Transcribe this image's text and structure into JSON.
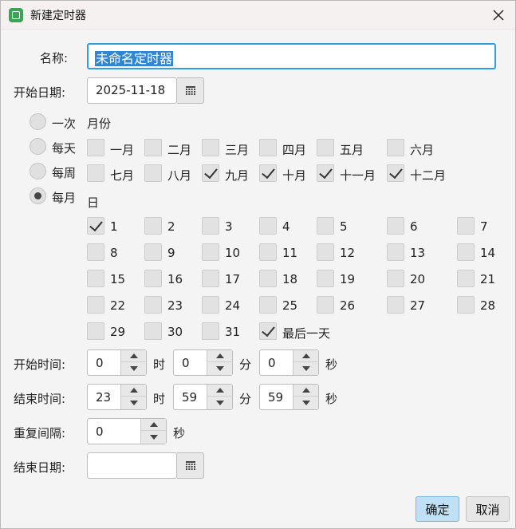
{
  "window": {
    "title": "新建定时器",
    "accent": "#2f9ee6"
  },
  "form": {
    "name_label": "名称:",
    "name_value": "未命名定时器",
    "start_date_label": "开始日期:",
    "start_date_value": "2025-11-18",
    "frequency": [
      {
        "label": "一次",
        "selected": false
      },
      {
        "label": "每天",
        "selected": false
      },
      {
        "label": "每周",
        "selected": false
      },
      {
        "label": "每月",
        "selected": true
      }
    ],
    "months_title": "月份",
    "months": [
      {
        "label": "一月",
        "checked": false
      },
      {
        "label": "二月",
        "checked": false
      },
      {
        "label": "三月",
        "checked": false
      },
      {
        "label": "四月",
        "checked": false
      },
      {
        "label": "五月",
        "checked": false
      },
      {
        "label": "六月",
        "checked": false
      },
      {
        "label": "七月",
        "checked": false
      },
      {
        "label": "八月",
        "checked": false
      },
      {
        "label": "九月",
        "checked": true
      },
      {
        "label": "十月",
        "checked": true
      },
      {
        "label": "十一月",
        "checked": true
      },
      {
        "label": "十二月",
        "checked": true
      }
    ],
    "days_title": "日",
    "days": [
      {
        "label": "1",
        "checked": true
      },
      {
        "label": "2",
        "checked": false
      },
      {
        "label": "3",
        "checked": false
      },
      {
        "label": "4",
        "checked": false
      },
      {
        "label": "5",
        "checked": false
      },
      {
        "label": "6",
        "checked": false
      },
      {
        "label": "7",
        "checked": false
      },
      {
        "label": "8",
        "checked": false
      },
      {
        "label": "9",
        "checked": false
      },
      {
        "label": "10",
        "checked": false
      },
      {
        "label": "11",
        "checked": false
      },
      {
        "label": "12",
        "checked": false
      },
      {
        "label": "13",
        "checked": false
      },
      {
        "label": "14",
        "checked": false
      },
      {
        "label": "15",
        "checked": false
      },
      {
        "label": "16",
        "checked": false
      },
      {
        "label": "17",
        "checked": false
      },
      {
        "label": "18",
        "checked": false
      },
      {
        "label": "19",
        "checked": false
      },
      {
        "label": "20",
        "checked": false
      },
      {
        "label": "21",
        "checked": false
      },
      {
        "label": "22",
        "checked": false
      },
      {
        "label": "23",
        "checked": false
      },
      {
        "label": "24",
        "checked": false
      },
      {
        "label": "25",
        "checked": false
      },
      {
        "label": "26",
        "checked": false
      },
      {
        "label": "27",
        "checked": false
      },
      {
        "label": "28",
        "checked": false
      },
      {
        "label": "29",
        "checked": false
      },
      {
        "label": "30",
        "checked": false
      },
      {
        "label": "31",
        "checked": false
      },
      {
        "label": "最后一天",
        "checked": true
      }
    ],
    "start_time_label": "开始时间:",
    "start_time": {
      "hour": "0",
      "minute": "0",
      "second": "0"
    },
    "end_time_label": "结束时间:",
    "end_time": {
      "hour": "23",
      "minute": "59",
      "second": "59"
    },
    "unit_hour": "时",
    "unit_minute": "分",
    "unit_second": "秒",
    "interval_label": "重复间隔:",
    "interval_value": "0",
    "interval_unit": "秒",
    "end_date_label": "结束日期:",
    "end_date_value": ""
  },
  "buttons": {
    "ok": "确定",
    "cancel": "取消"
  }
}
